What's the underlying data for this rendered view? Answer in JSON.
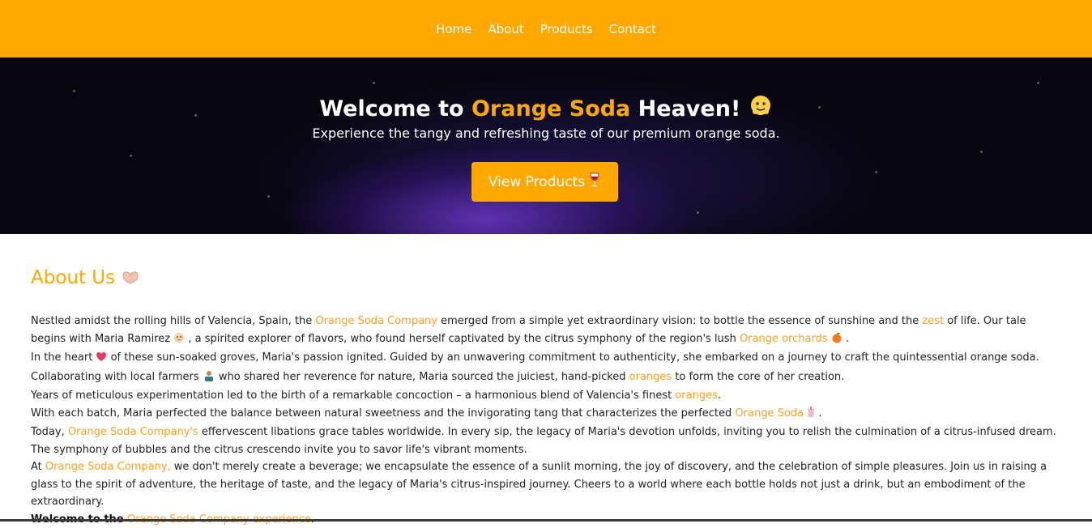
{
  "nav": {
    "items": [
      "Home",
      "About",
      "Products",
      "Contact"
    ],
    "bg_color": "#ffa800"
  },
  "hero": {
    "title_prefix": "Welcome to ",
    "title_accent": "Orange Soda",
    "title_suffix": " Heaven!",
    "title_icon": "blob-emoji-icon",
    "subtitle": "Experience the tangy and refreshing taste of our premium orange soda.",
    "button_label": "View Products",
    "button_icon": "wine-glass-icon"
  },
  "about": {
    "heading": "About Us",
    "heading_icon": "heart-hands-icon",
    "p1": {
      "a": "Nestled amidst the rolling hills of Valencia, Spain, the ",
      "b": "Orange Soda Company",
      "c": " emerged from a simple yet extraordinary vision: to bottle the essence of sunshine and the ",
      "d": "zest",
      "e": " of life. Our tale begins with Maria Ramirez ",
      "f": " , a spirited explorer of flavors, who found herself captivated by the citrus symphony of the region's lush ",
      "g": "Orange orchards",
      "h": " ."
    },
    "p2": {
      "a": "In the heart ",
      "b": " of these sun-soaked groves, Maria's passion ignited. Guided by an unwavering commitment to authenticity, she embarked on a journey to craft the quintessential orange soda."
    },
    "p3": {
      "a": "Collaborating with local farmers ",
      "b": " who shared her reverence for nature, Maria sourced the juiciest, hand-picked ",
      "c": "oranges",
      "d": " to form the core of her creation."
    },
    "p4": {
      "a": "Years of meticulous experimentation led to the birth of a remarkable concoction – a harmonious blend of Valencia's finest ",
      "b": "oranges",
      "c": "."
    },
    "p5": {
      "a": "With each batch, Maria perfected the balance between natural sweetness and the invigorating tang that characterizes the perfected ",
      "b": "Orange Soda",
      "c": " ."
    },
    "p6": {
      "a": "Today, ",
      "b": "Orange Soda Company's",
      "c": " effervescent libations grace tables worldwide. In every sip, the legacy of Maria's devotion unfolds, inviting you to relish the culmination of a citrus-infused dream. The symphony of bubbles and the citrus crescendo invite you to savor life's vibrant moments."
    },
    "p7": {
      "a": "At ",
      "b": "Orange Soda Company,",
      "c": " we don't merely create a beverage; we encapsulate the essence of a sunlit morning, the joy of discovery, and the celebration of simple pleasures. Join us in raising a glass to the spirit of adventure, the heritage of taste, and the legacy of Maria's citrus-inspired journey. Cheers to a world where each bottle holds not just a drink, but an embodiment of the extraordinary."
    },
    "p8": {
      "a": "Welcome to the ",
      "b": "Orange Soda Company experience",
      "c": "."
    }
  },
  "colors": {
    "accent": "#ffa800",
    "link": "#ffa020",
    "hero_bg": "#07060f"
  }
}
